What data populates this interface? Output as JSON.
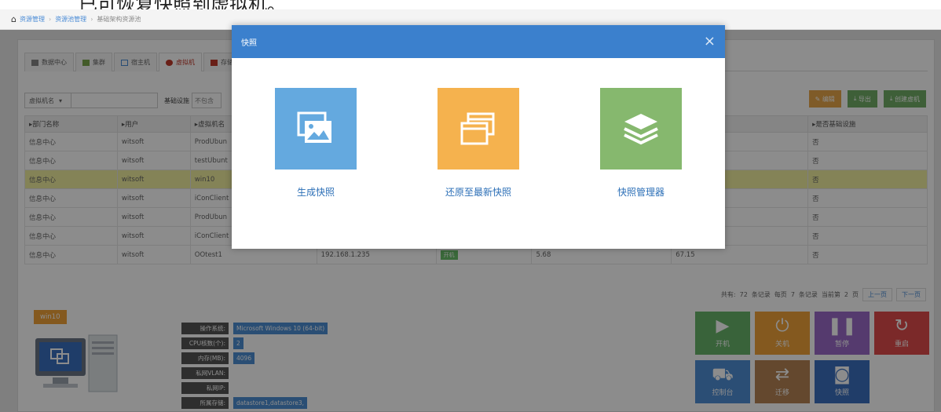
{
  "page_header": {
    "cut_text": "已可恢复快照到虚拟机。"
  },
  "breadcrumb": {
    "items": [
      "资源管理",
      "资源池管理",
      "基础架构资源池"
    ]
  },
  "tabs": [
    {
      "label": "数据中心",
      "icon": "server-icon",
      "color": "#777"
    },
    {
      "label": "集群",
      "icon": "cluster-icon",
      "color": "#7aa64b"
    },
    {
      "label": "宿主机",
      "icon": "host-monitor-icon",
      "color": "#4a8bd6"
    },
    {
      "label": "虚拟机",
      "icon": "vm-icon",
      "color": "#c0392b",
      "active": true
    },
    {
      "label": "存储",
      "icon": "storage-icon",
      "color": "#c0392b"
    }
  ],
  "filters": {
    "field_select": "虚拟机名",
    "search_value": "",
    "infra_label": "基础设施",
    "infra_select": "不包含"
  },
  "toolbar": {
    "edit": "编辑",
    "export": "导出",
    "create": "创建虚机"
  },
  "table": {
    "headers": [
      "部门名称",
      "用户",
      "虚拟机名",
      "",
      "",
      "",
      "",
      "是否基础设施"
    ],
    "rows": [
      {
        "dept": "信息中心",
        "user": "witsoft",
        "vm": "ProdUbun",
        "ip": "",
        "status": "",
        "cpu": "",
        "mem": "",
        "infra": "否"
      },
      {
        "dept": "信息中心",
        "user": "witsoft",
        "vm": "testUbunt",
        "ip": "",
        "status": "",
        "cpu": "",
        "mem": "",
        "infra": "否"
      },
      {
        "dept": "信息中心",
        "user": "witsoft",
        "vm": "win10",
        "ip": "",
        "status": "",
        "cpu": "",
        "mem": "",
        "infra": "否",
        "selected": true
      },
      {
        "dept": "信息中心",
        "user": "witsoft",
        "vm": "iConClient",
        "ip": "",
        "status": "",
        "cpu": "",
        "mem": "",
        "infra": "否"
      },
      {
        "dept": "信息中心",
        "user": "witsoft",
        "vm": "ProdUbun",
        "ip": "",
        "status": "",
        "cpu": "",
        "mem": "",
        "infra": "否"
      },
      {
        "dept": "信息中心",
        "user": "witsoft",
        "vm": "iConClient",
        "ip": "",
        "status": "",
        "cpu": "",
        "mem": "",
        "infra": "否"
      },
      {
        "dept": "信息中心",
        "user": "witsoft",
        "vm": "OOtest1",
        "ip": "192.168.1.235",
        "status": "开机",
        "cpu": "5.68",
        "mem": "67.15",
        "infra": "否"
      }
    ]
  },
  "pagination": {
    "total_prefix": "共有:",
    "total": "72",
    "records_unit": "条记录",
    "per_page_prefix": "每页",
    "per_page": "7",
    "current_prefix": "当前第",
    "current": "2",
    "page_unit": "页",
    "prev": "上一页",
    "next": "下一页"
  },
  "vm_detail": {
    "name": "win10",
    "info": [
      {
        "key": "操作系统:",
        "value": "Microsoft Windows 10 (64-bit)"
      },
      {
        "key": "CPU核数(个):",
        "value": "2"
      },
      {
        "key": "内存(MB):",
        "value": "4096"
      },
      {
        "key": "私网VLAN:",
        "value": ""
      },
      {
        "key": "私网IP:",
        "value": ""
      },
      {
        "key": "所属存储:",
        "value": "datastore1,datastore3,"
      }
    ]
  },
  "actions": [
    {
      "label": "开机",
      "glyph": "▶",
      "icon": "play-icon",
      "color": "#68b56b"
    },
    {
      "label": "关机",
      "glyph": "⏻",
      "icon": "power-icon",
      "color": "#f0a33a"
    },
    {
      "label": "暂停",
      "glyph": "❚❚",
      "icon": "pause-icon",
      "color": "#9b6bc9"
    },
    {
      "label": "重启",
      "glyph": "↻",
      "icon": "restart-icon",
      "color": "#e04b4b"
    },
    {
      "label": "控制台",
      "glyph": "⛟",
      "icon": "console-icon",
      "color": "#4f8fd6"
    },
    {
      "label": "迁移",
      "glyph": "⇄",
      "icon": "migrate-icon",
      "color": "#b68454"
    },
    {
      "label": "快照",
      "glyph": "◙",
      "icon": "camera-icon",
      "color": "#3b6fc0"
    }
  ],
  "modal": {
    "title": "快照",
    "close": "×",
    "options": [
      {
        "label": "生成快照",
        "icon": "image-icon",
        "color": "#64a9df"
      },
      {
        "label": "还原至最新快照",
        "icon": "windows-stack-icon",
        "color": "#f5b24e"
      },
      {
        "label": "快照管理器",
        "icon": "layers-icon",
        "color": "#86b86e"
      }
    ]
  }
}
